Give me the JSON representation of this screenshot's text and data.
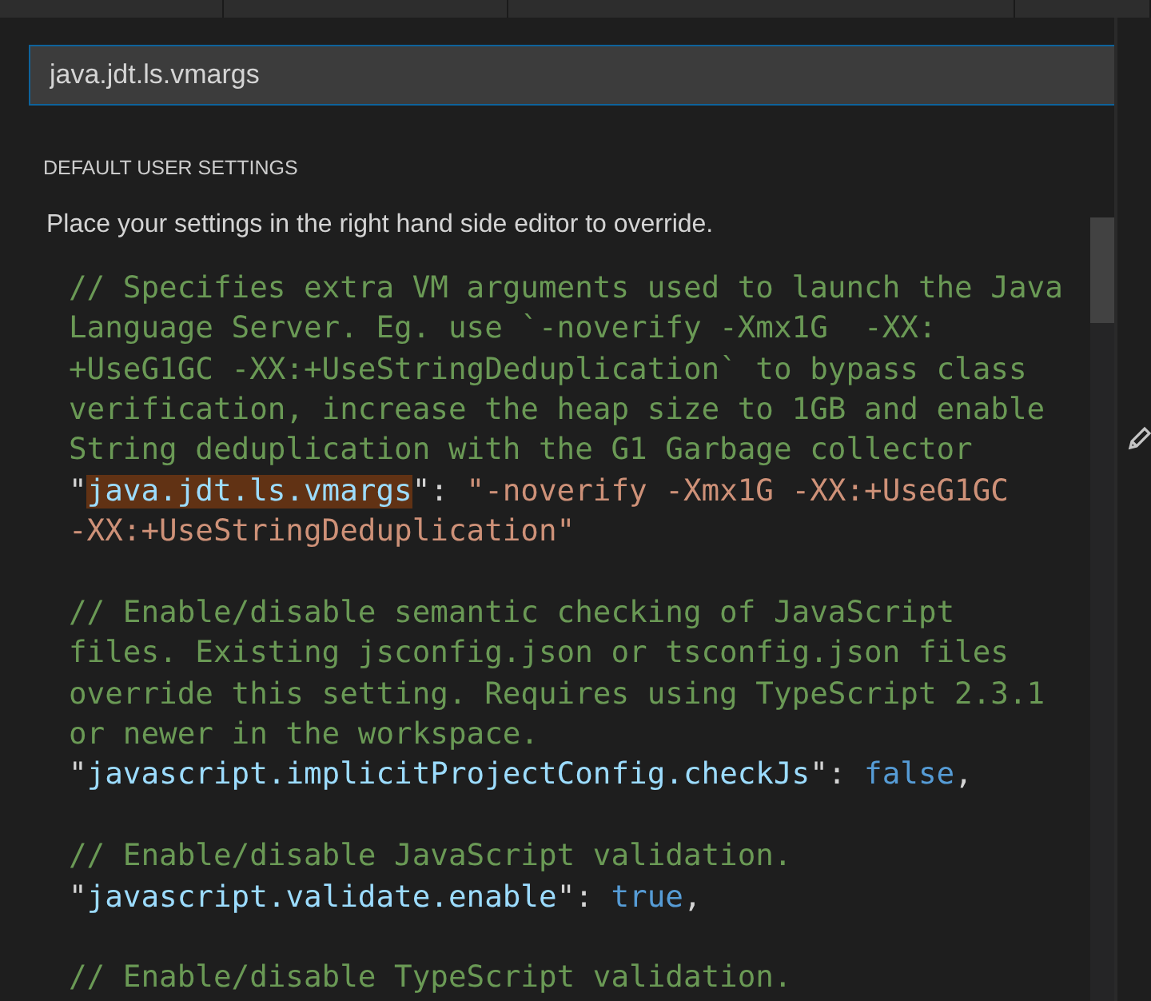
{
  "search": {
    "value": "java.jdt.ls.vmargs"
  },
  "section_title": "DEFAULT USER SETTINGS",
  "description": "Place your settings in the right hand side editor to override.",
  "settings": [
    {
      "comment_lines": [
        "// Specifies extra VM arguments used to launch the Java",
        "Language Server. Eg. use `-noverify -Xmx1G  -XX:",
        "+UseG1GC -XX:+UseStringDeduplication` to bypass class",
        "verification, increase the heap size to 1GB and enable",
        "String deduplication with the G1 Garbage collector"
      ],
      "code_lines": [
        [
          {
            "kind": "punct",
            "text": "\""
          },
          {
            "kind": "key",
            "text": "java.jdt.ls.vmargs",
            "highlighted": true
          },
          {
            "kind": "punct",
            "text": "\": "
          },
          {
            "kind": "string",
            "text": "\"-noverify -Xmx1G -XX:+UseG1GC"
          }
        ],
        [
          {
            "kind": "string",
            "text": "-XX:+UseStringDeduplication\""
          }
        ]
      ]
    },
    {
      "comment_lines": [
        "// Enable/disable semantic checking of JavaScript",
        "files. Existing jsconfig.json or tsconfig.json files",
        "override this setting. Requires using TypeScript 2.3.1",
        "or newer in the workspace."
      ],
      "code_lines": [
        [
          {
            "kind": "punct",
            "text": "\""
          },
          {
            "kind": "key",
            "text": "javascript.implicitProjectConfig.checkJs",
            "highlighted": false
          },
          {
            "kind": "punct",
            "text": "\": "
          },
          {
            "kind": "keyword",
            "text": "false"
          },
          {
            "kind": "punct",
            "text": ","
          }
        ]
      ]
    },
    {
      "comment_lines": [
        "// Enable/disable JavaScript validation."
      ],
      "code_lines": [
        [
          {
            "kind": "punct",
            "text": "\""
          },
          {
            "kind": "key",
            "text": "javascript.validate.enable",
            "highlighted": false
          },
          {
            "kind": "punct",
            "text": "\": "
          },
          {
            "kind": "keyword",
            "text": "true"
          },
          {
            "kind": "punct",
            "text": ","
          }
        ]
      ]
    },
    {
      "comment_lines": [
        "// Enable/disable TypeScript validation."
      ]
    }
  ]
}
